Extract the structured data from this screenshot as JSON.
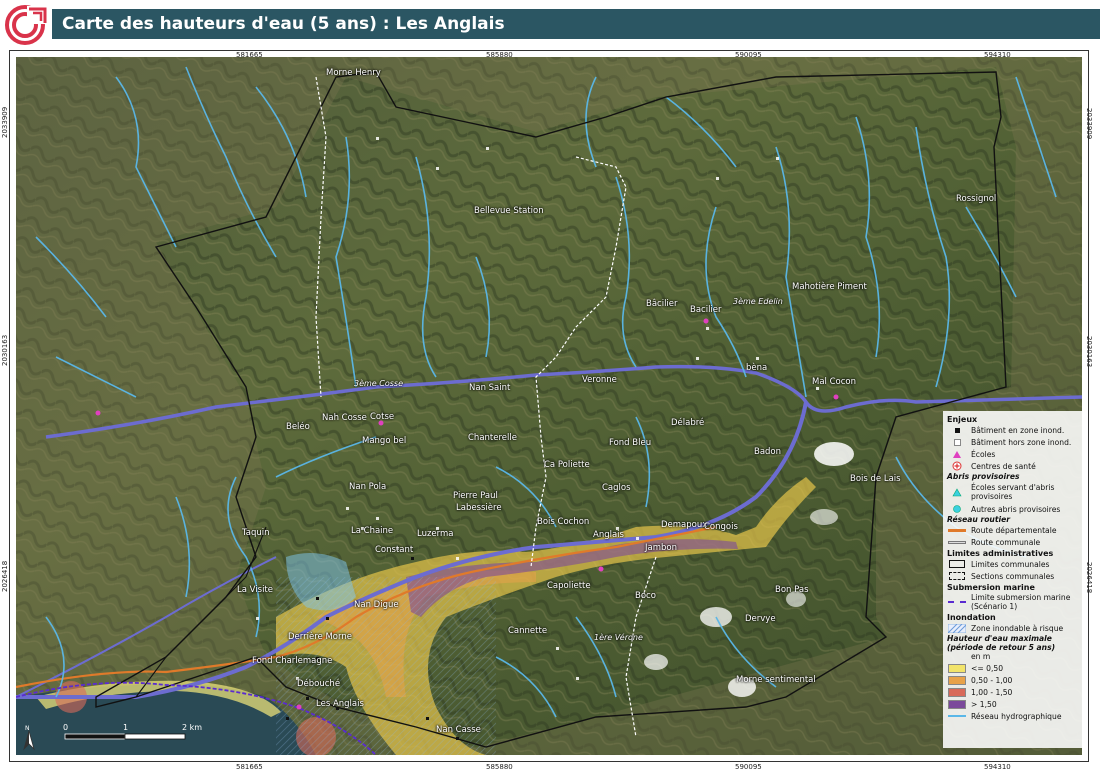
{
  "header": {
    "title": "Carte des hauteurs d'eau (5 ans) : Les Anglais"
  },
  "coords": {
    "x_top": [
      "581665",
      "585880",
      "590095",
      "594310"
    ],
    "x_bottom": [
      "581665",
      "585880",
      "590095",
      "594310"
    ],
    "y_left": [
      "2033909",
      "2030163",
      "2026418"
    ],
    "y_right": [
      "2033909",
      "2030163",
      "2026418"
    ]
  },
  "places": {
    "morne_henry": "Morne Henry",
    "bellevue": "Bellevue Station",
    "rossignol": "Rossignol",
    "bacilier1": "Bâcilier",
    "bacilier2": "Bacilier",
    "mahotiere": "Mahotière Piment",
    "nan_saint": "Nan Saint",
    "veronne": "Veronne",
    "bena": "bèna",
    "mal_cocon": "Mal Cocon",
    "nan_cosse": "Nah Cosse",
    "cotse": "Cotse",
    "beleo": "Beléo",
    "mangobe": "Mango bel",
    "chanterelle": "Chanterelle",
    "fond_bleu": "Fond Bleu",
    "delabre": "Délabré",
    "badon": "Badon",
    "bois_de_lais": "Bois de Lais",
    "ca_poliette": "Ca Poliette",
    "caglos": "Caglos",
    "nan_pola": "Nan Pola",
    "pierre_paul": "Pierre Paul",
    "labessiere": "Labessière",
    "bois_cochon": "Bois Cochon",
    "demapoux": "Demapoux",
    "congois": "Congois",
    "taquin": "Taquin",
    "la_chaine": "La Chaine",
    "luzerma": "Luzerma",
    "constant": "Constant",
    "anglais": "Anglais",
    "jambon": "Jambon",
    "la_visite": "La Visite",
    "capoliette": "Capoliette",
    "boco": "Boco",
    "bon_pas": "Bon Pas",
    "nan_digue": "Nan Digue",
    "derriere_morne": "Derrière Morne",
    "cannette": "Cannette",
    "dervye": "Dervye",
    "fond_charlemagne": "Fond Charlemagne",
    "debouche": "Débouché",
    "les_anglais": "Les Anglais",
    "morne_sentimental": "Morne sentimental",
    "nan_casse": "Nan Casse"
  },
  "river_labels": {
    "r1": "3ème Cosse",
    "r2": "3ème Edelin",
    "r3": "1ère Vérone"
  },
  "legend": {
    "enjeux": "Enjeux",
    "bat_in": "Bâtiment en zone inond.",
    "bat_out": "Bâtiment hors zone inond.",
    "ecoles": "Écoles",
    "sante": "Centres de santé",
    "abris_title": "Abris provisoires",
    "abris_ecoles": "Écoles servant d'abris provisoires",
    "abris_autres": "Autres abris provisoires",
    "reseau_title": "Réseau routier",
    "route_dep": "Route départementale",
    "route_com": "Route communale",
    "limites_title": "Limites administratives",
    "lim_com": "Limites communales",
    "sections": "Sections communales",
    "submersion_title": "Submersion marine",
    "lim_sub": "Limite submersion marine (Scénario 1)",
    "inondation_title": "Inondation",
    "zone_inond": "Zone inondable à risque",
    "hauteur_title": "Hauteur d'eau maximale (période de retour 5 ans)",
    "unit": "en m",
    "c1": "<= 0,50",
    "c2": "0,50 - 1,00",
    "c3": "1,00 - 1,50",
    "c4": "> 1,50",
    "hydro": "Réseau hydrographique"
  },
  "scale": {
    "t0": "0",
    "t1": "1",
    "t2": "2 km"
  },
  "north": "N",
  "colors": {
    "title_bar": "#2b5663",
    "class1": "#f2e46b",
    "class2": "#e8a24a",
    "class3": "#d86a5a",
    "class4": "#7b4a9b",
    "river": "#5ab7e8",
    "route_dep": "#e07a2a"
  }
}
